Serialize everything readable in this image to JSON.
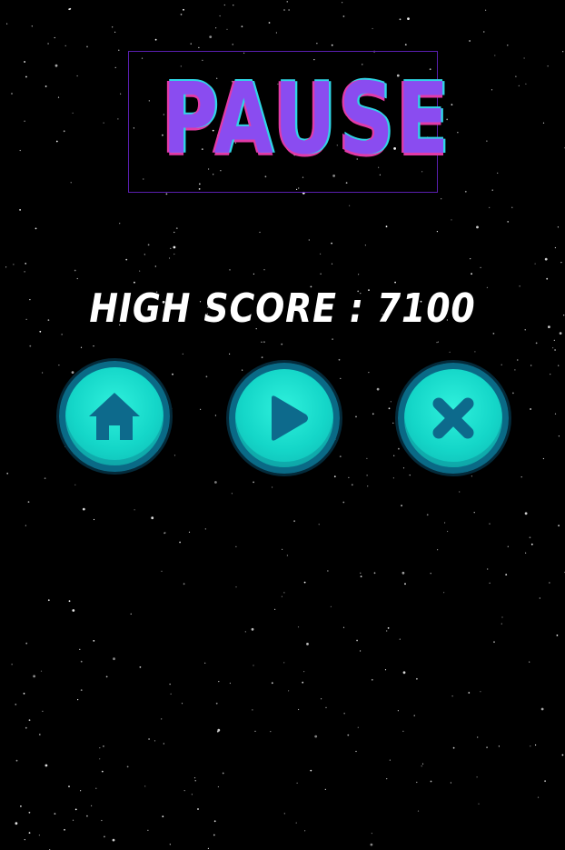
{
  "screen": {
    "title": "PAUSE",
    "high_score_label": "HIGH SCORE : 7100",
    "high_score_value": 7100
  },
  "buttons": {
    "home": {
      "icon": "home-icon"
    },
    "play": {
      "icon": "play-icon"
    },
    "close": {
      "icon": "close-icon"
    }
  },
  "colors": {
    "background": "#000000",
    "title_fill": "#8a4cf0",
    "title_outline_cyan": "#2fd6e6",
    "title_outline_pink": "#e23aa7",
    "button_fill": "#14d6c8",
    "button_rim": "#0a6a86",
    "icon": "#0d6a8c"
  }
}
